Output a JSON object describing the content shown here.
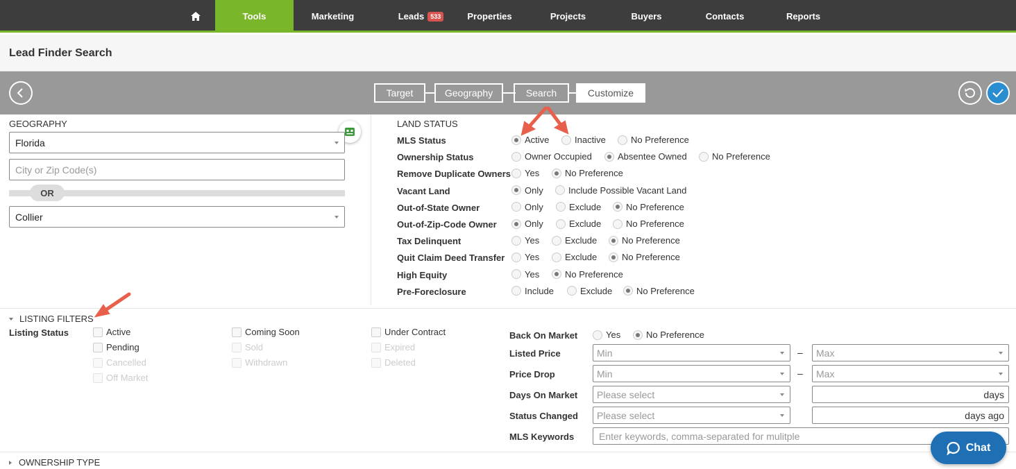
{
  "nav": {
    "home_icon": "home-icon",
    "items": [
      {
        "label": "Tools",
        "active": true
      },
      {
        "label": "Marketing"
      },
      {
        "label": "Leads",
        "badge": "533"
      },
      {
        "label": "Properties"
      },
      {
        "label": "Projects"
      },
      {
        "label": "Buyers"
      },
      {
        "label": "Contacts"
      },
      {
        "label": "Reports"
      }
    ],
    "accent_color": "#7ab629"
  },
  "page_title": "Lead Finder Search",
  "steps": [
    "Target",
    "Geography",
    "Search",
    "Customize"
  ],
  "current_step": "Customize",
  "geography": {
    "label": "GEOGRAPHY",
    "state": "Florida",
    "city_zip_placeholder": "City or Zip Code(s)",
    "or_label": "OR",
    "county": "Collier"
  },
  "land_status": {
    "label": "LAND STATUS",
    "rows": [
      {
        "label": "MLS Status",
        "options": [
          "Active",
          "Inactive",
          "No Preference"
        ],
        "selected": 0
      },
      {
        "label": "Ownership Status",
        "options": [
          "Owner Occupied",
          "Absentee Owned",
          "No Preference"
        ],
        "selected": 1
      },
      {
        "label": "Remove Duplicate Owners",
        "options": [
          "Yes",
          "No Preference"
        ],
        "selected": 1
      },
      {
        "label": "Vacant Land",
        "options": [
          "Only",
          "Include Possible Vacant Land"
        ],
        "selected": 0
      },
      {
        "label": "Out-of-State Owner",
        "options": [
          "Only",
          "Exclude",
          "No Preference"
        ],
        "selected": 2
      },
      {
        "label": "Out-of-Zip-Code Owner",
        "options": [
          "Only",
          "Exclude",
          "No Preference"
        ],
        "selected": 0
      },
      {
        "label": "Tax Delinquent",
        "options": [
          "Yes",
          "Exclude",
          "No Preference"
        ],
        "selected": 2
      },
      {
        "label": "Quit Claim Deed Transfer",
        "options": [
          "Yes",
          "Exclude",
          "No Preference"
        ],
        "selected": 2
      },
      {
        "label": "High Equity",
        "options": [
          "Yes",
          "No Preference"
        ],
        "selected": 1
      },
      {
        "label": "Pre-Foreclosure",
        "options": [
          "Include",
          "Exclude",
          "No Preference"
        ],
        "selected": 2
      }
    ]
  },
  "listing_filters": {
    "header": "LISTING FILTERS",
    "status_label": "Listing Status",
    "statuses": [
      {
        "label": "Active",
        "disabled": false
      },
      {
        "label": "Coming Soon",
        "disabled": false
      },
      {
        "label": "Under Contract",
        "disabled": false
      },
      {
        "label": "Pending",
        "disabled": false
      },
      {
        "label": "Sold",
        "disabled": true
      },
      {
        "label": "Expired",
        "disabled": true
      },
      {
        "label": "Cancelled",
        "disabled": true
      },
      {
        "label": "Withdrawn",
        "disabled": true
      },
      {
        "label": "Deleted",
        "disabled": true
      },
      {
        "label": "Off Market",
        "disabled": true
      }
    ],
    "back_on_market": {
      "label": "Back On Market",
      "options": [
        "Yes",
        "No Preference"
      ],
      "selected": 1
    },
    "listed_price": {
      "label": "Listed Price",
      "min": "Min",
      "max": "Max",
      "dash": "–"
    },
    "price_drop": {
      "label": "Price Drop",
      "min": "Min",
      "max": "Max",
      "dash": "–"
    },
    "days_on_market": {
      "label": "Days On Market",
      "placeholder": "Please select",
      "unit": "days"
    },
    "status_changed": {
      "label": "Status Changed",
      "placeholder": "Please select",
      "unit": "days ago"
    },
    "mls_keywords": {
      "label": "MLS Keywords",
      "placeholder": "Enter keywords, comma-separated for mulitple"
    }
  },
  "ownership_type": {
    "header": "OWNERSHIP TYPE"
  },
  "chat": {
    "label": "Chat"
  }
}
